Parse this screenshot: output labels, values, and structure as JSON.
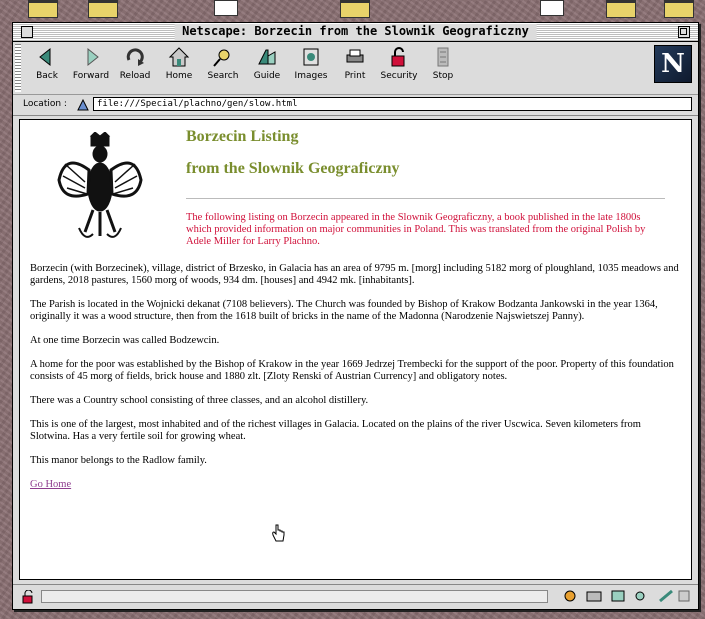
{
  "window": {
    "title": "Netscape: Borzecin from the Slownik Geograficzny"
  },
  "toolbar": {
    "buttons": [
      {
        "label": "Back",
        "icon": "back-arrow-icon"
      },
      {
        "label": "Forward",
        "icon": "forward-arrow-icon"
      },
      {
        "label": "Reload",
        "icon": "reload-icon"
      },
      {
        "label": "Home",
        "icon": "home-icon"
      },
      {
        "label": "Search",
        "icon": "search-icon"
      },
      {
        "label": "Guide",
        "icon": "guide-icon"
      },
      {
        "label": "Images",
        "icon": "images-icon"
      },
      {
        "label": "Print",
        "icon": "print-icon"
      },
      {
        "label": "Security",
        "icon": "security-lock-icon"
      },
      {
        "label": "Stop",
        "icon": "stop-icon"
      }
    ],
    "logo_letter": "N"
  },
  "location": {
    "label": "Location :",
    "url": "file:///Special/plachno/gen/slow.html"
  },
  "page": {
    "heading1": "Borzecin Listing",
    "heading2": "from the Slownik Geograficzny",
    "intro": "The following listing on Borzecin appeared in the Slownik Geograficzny, a book published in the late 1800s which provided information on major communities in Poland. This was translated from the original Polish by Adele Miller for Larry Plachno.",
    "paragraphs": [
      "Borzecin (with Borzecinek), village, district of Brzesko, in Galacia has an area of 9795 m. [morg] including 5182 morg of ploughland, 1035 meadows and gardens, 2018 pastures, 1560 morg of woods, 934 dm. [houses] and 4942 mk. [inhabitants].",
      "The Parish is located in the Wojnicki dekanat (7108 believers). The Church was founded by Bishop of Krakow Bodzanta Jankowski in the year 1364, originally it was a wood structure, then from the 1618 built of bricks in the name of the Madonna (Narodzenie Najswietszej Panny).",
      "At one time Borzecin was called Bodzewcin.",
      "A home for the poor was established by the Bishop of Krakow in the year 1669 Jedrzej Trembecki for the support of the poor. Property of this foundation consists of 45 morg of fields, brick house and 1880 zlt. [Zloty Renski of Austrian Currency] and obligatory notes.",
      "There was a Country school consisting of three classes, and an alcohol distillery.",
      "This is one of the largest, most inhabited and of the richest villages in Galacia. Located on the plains of the river Uscwica. Seven kilometers from Slotwina. Has a very fertile soil for growing wheat.",
      "This manor belongs to the Radlow family."
    ],
    "link": "Go Home"
  },
  "status": {
    "text": ""
  },
  "colors": {
    "heading": "#7a8e2e",
    "intro_text": "#d0103a",
    "link_visited": "#8e3c8e",
    "desktop": "#8a6f72"
  }
}
